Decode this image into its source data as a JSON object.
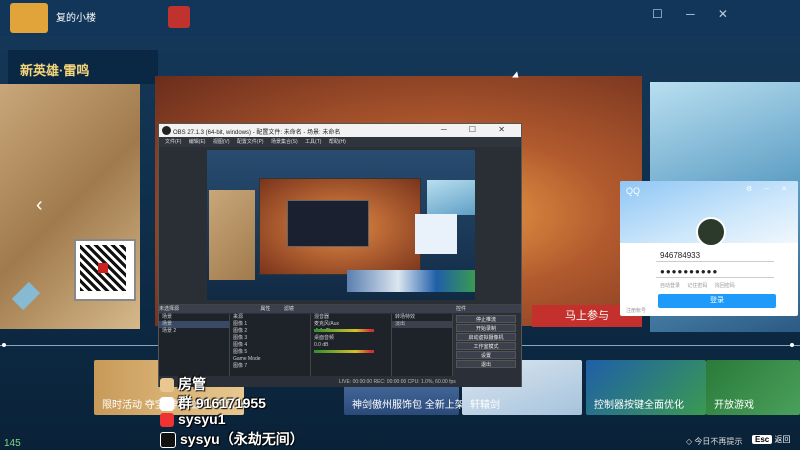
{
  "topbar": {
    "username": "复的小楼",
    "icons": [
      "chat-icon",
      "minimize-icon",
      "close-icon"
    ]
  },
  "left_card": {
    "title": "新英雄·雷鸣"
  },
  "banner": {
    "join_label": "马上参与"
  },
  "tiles": [
    {
      "label": "限时活动 夺宝·神威·凶兵·百练洞"
    },
    {
      "label": "神剑傲州服饰包 全新上架"
    },
    {
      "label": "轩辕剑"
    },
    {
      "label": "控制器按键全面优化"
    },
    {
      "label": "开放游戏"
    }
  ],
  "fps_counter": "145",
  "bottom_hints": {
    "hide_label": "今日不再提示",
    "esc_key": "Esc",
    "back_label": "返回"
  },
  "obs": {
    "title": "OBS 27.1.3 (64-bit, windows) - 配置文件: 未命名 - 场景: 未命名",
    "menu": [
      "文件(F)",
      "编辑(E)",
      "视图(V)",
      "配置文件(P)",
      "场景集合(S)",
      "工具(T)",
      "帮助(H)"
    ],
    "source_bar_label": "未选择源",
    "props_label": "属性",
    "filters_label": "滤镜",
    "docks": {
      "scenes": "场景",
      "sources": "来源",
      "mixer": "混音器",
      "transitions": "转场特效",
      "controls": "控件"
    },
    "scenes": [
      "场景",
      "场景 2"
    ],
    "sources": [
      "图像 1",
      "图像 2",
      "图像 3",
      "图像 4",
      "图像 5",
      "Game Mode",
      "图像 7"
    ],
    "mixer": [
      {
        "name": "麦克风/Aux",
        "level": "-1.1 dB"
      },
      {
        "name": "桌面音频",
        "level": "0.0 dB"
      }
    ],
    "transition": "淡出",
    "controls": [
      "停止推流",
      "开始录制",
      "启动虚拟摄像机",
      "工作室模式",
      "设置",
      "退出"
    ],
    "status": "LIVE: 00:00:00   REC: 00:00:00   CPU: 1.0%, 60.00 fps"
  },
  "qq": {
    "logo": "QQ",
    "account": "946784933",
    "password_mask": "●●●●●●●●●●",
    "opts": [
      "自动登录",
      "记住密码",
      "找回密码"
    ],
    "login_button": "登录",
    "register_label": "注册帐号"
  },
  "overlay": [
    {
      "icon": "mascot-icon",
      "text": "房管"
    },
    {
      "icon": "qq-icon",
      "text": "群 916171955"
    },
    {
      "icon": "weibo-icon",
      "text": "sysyu1"
    },
    {
      "icon": "tiktok-icon",
      "text": "sysyu（永劫无间）"
    }
  ]
}
